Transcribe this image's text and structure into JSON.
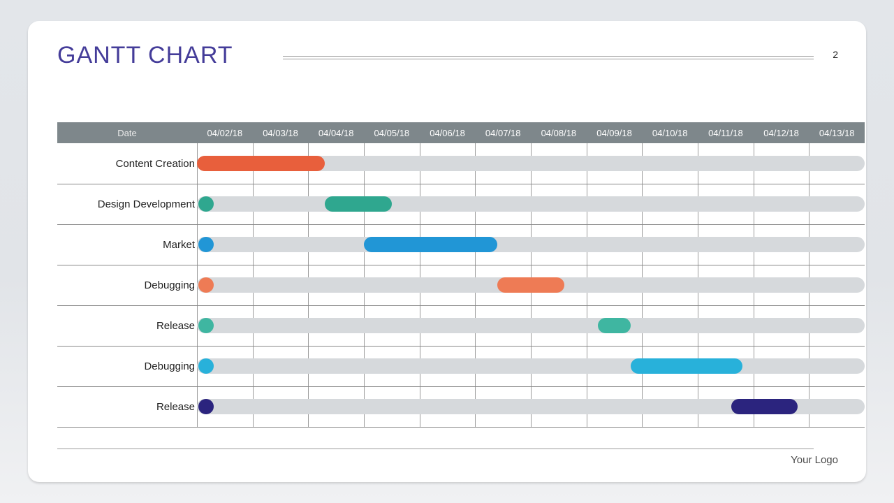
{
  "title": "GANTT CHART",
  "page_number": "2",
  "footer_logo": "Your Logo",
  "header_date_label": "Date",
  "chart_data": {
    "type": "bar",
    "orientation": "horizontal-gantt",
    "categories": [
      "04/02/18",
      "04/03/18",
      "04/04/18",
      "04/05/18",
      "04/06/18",
      "04/07/18",
      "04/08/18",
      "04/09/18",
      "04/10/18",
      "04/11/18",
      "04/12/18",
      "04/13/18"
    ],
    "tasks": [
      {
        "name": "Content Creation",
        "start": "04/02/18",
        "end": "04/04/18",
        "start_idx": 0.0,
        "end_idx": 2.3,
        "color": "#e85f3c",
        "marker": false
      },
      {
        "name": "Design Development",
        "start": "04/04/18",
        "end": "04/05/18",
        "start_idx": 2.3,
        "end_idx": 3.5,
        "color": "#2fa78f",
        "marker": true
      },
      {
        "name": "Market",
        "start": "04/05/18",
        "end": "04/07/18",
        "start_idx": 3.0,
        "end_idx": 5.4,
        "color": "#2196d6",
        "marker": true
      },
      {
        "name": "Debugging",
        "start": "04/07/18",
        "end": "04/08/18",
        "start_idx": 5.4,
        "end_idx": 6.6,
        "color": "#ee7b55",
        "marker": true
      },
      {
        "name": "Release",
        "start": "04/09/18",
        "end": "04/09/18",
        "start_idx": 7.2,
        "end_idx": 7.8,
        "color": "#3fb6a1",
        "marker": true
      },
      {
        "name": "Debugging",
        "start": "04/10/18",
        "end": "04/11/18",
        "start_idx": 7.8,
        "end_idx": 9.8,
        "color": "#28b1da",
        "marker": true
      },
      {
        "name": "Release",
        "start": "04/11/18",
        "end": "04/12/18",
        "start_idx": 9.6,
        "end_idx": 10.8,
        "color": "#2b247e",
        "marker": true
      }
    ]
  }
}
